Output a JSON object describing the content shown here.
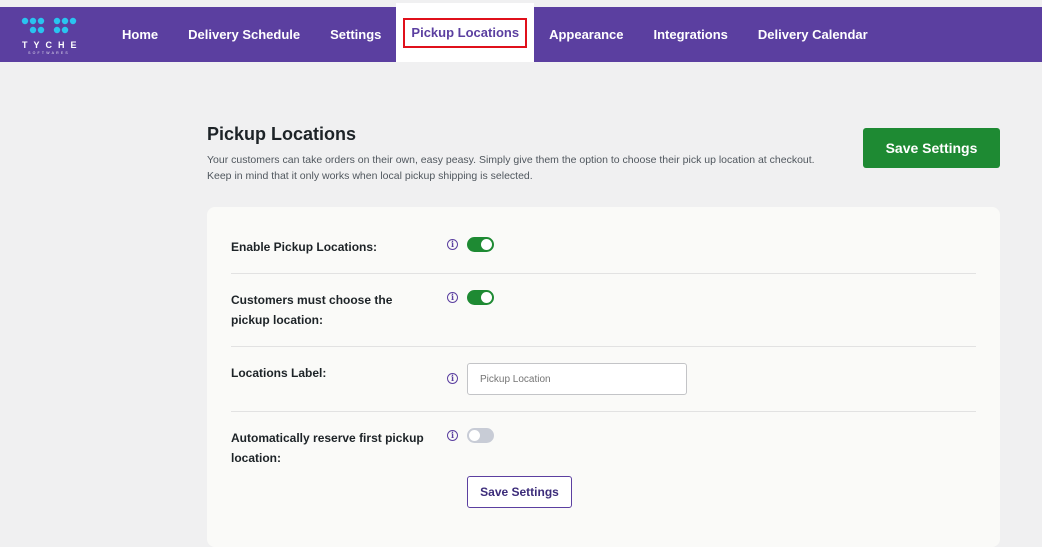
{
  "brand": {
    "name": "TYCHE",
    "subtitle": "SOFTWARES",
    "dot_color": "#29c4f0"
  },
  "nav": {
    "items": [
      {
        "label": "Home"
      },
      {
        "label": "Delivery Schedule"
      },
      {
        "label": "Settings"
      },
      {
        "label": "Pickup Locations",
        "active": true
      },
      {
        "label": "Appearance"
      },
      {
        "label": "Integrations"
      },
      {
        "label": "Delivery Calendar"
      }
    ]
  },
  "page": {
    "title": "Pickup Locations",
    "description": "Your customers can take orders on their own, easy peasy. Simply give them the option to choose their pick up location at checkout. Keep in mind that it only works when local pickup shipping is selected.",
    "save_label": "Save Settings"
  },
  "settings": {
    "enable_pickup": {
      "label": "Enable Pickup Locations:",
      "enabled": true,
      "info_icon": "info-icon"
    },
    "must_choose": {
      "label": "Customers must choose the pickup location:",
      "enabled": true,
      "info_icon": "info-icon"
    },
    "locations_label": {
      "label": "Locations Label:",
      "placeholder": "Pickup Location",
      "value": "",
      "info_icon": "info-icon"
    },
    "auto_reserve": {
      "label": "Automatically reserve first pickup location:",
      "enabled": false,
      "info_icon": "info-icon"
    },
    "save_label": "Save Settings"
  },
  "colors": {
    "header_bg": "#5b3fa0",
    "accent_green": "#1e8a33",
    "active_tab_highlight": "#e0101b",
    "toggle_off": "#c8ccd6"
  }
}
